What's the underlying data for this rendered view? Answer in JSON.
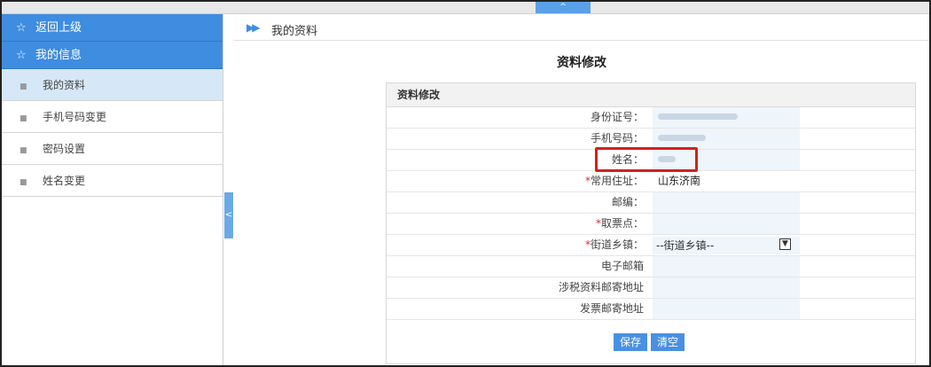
{
  "topbar": {
    "collapse_label": "^"
  },
  "sidebar": {
    "headers": [
      {
        "label": "返回上级",
        "icon": "star-icon"
      },
      {
        "label": "我的信息",
        "icon": "star-icon"
      }
    ],
    "items": [
      {
        "label": "我的资料",
        "active": true
      },
      {
        "label": "手机号码变更",
        "active": false
      },
      {
        "label": "密码设置",
        "active": false
      },
      {
        "label": "姓名变更",
        "active": false
      }
    ],
    "collapse_label": "<"
  },
  "breadcrumb": {
    "text": "我的资料"
  },
  "page_title": "资料修改",
  "form": {
    "section_title": "资料修改",
    "fields": [
      {
        "label": "身份证号：",
        "required": false,
        "value": ""
      },
      {
        "label": "手机号码：",
        "required": false,
        "value": ""
      },
      {
        "label": "姓名：",
        "required": false,
        "value": ""
      },
      {
        "label": "常用住址：",
        "required": true,
        "value": "山东济南"
      },
      {
        "label": "邮编：",
        "required": false,
        "value": ""
      },
      {
        "label": "取票点：",
        "required": true,
        "value": ""
      },
      {
        "label": "街道乡镇：",
        "required": true,
        "value": "--街道乡镇--"
      },
      {
        "label": "电子邮箱",
        "required": false,
        "value": ""
      },
      {
        "label": "涉税资料邮寄地址",
        "required": false,
        "value": ""
      },
      {
        "label": "发票邮寄地址",
        "required": false,
        "value": ""
      }
    ],
    "buttons": {
      "save": "保存",
      "clear": "清空"
    },
    "required_mark": "*"
  },
  "colors": {
    "accent": "#3f8de0",
    "highlight": "#d32020"
  }
}
